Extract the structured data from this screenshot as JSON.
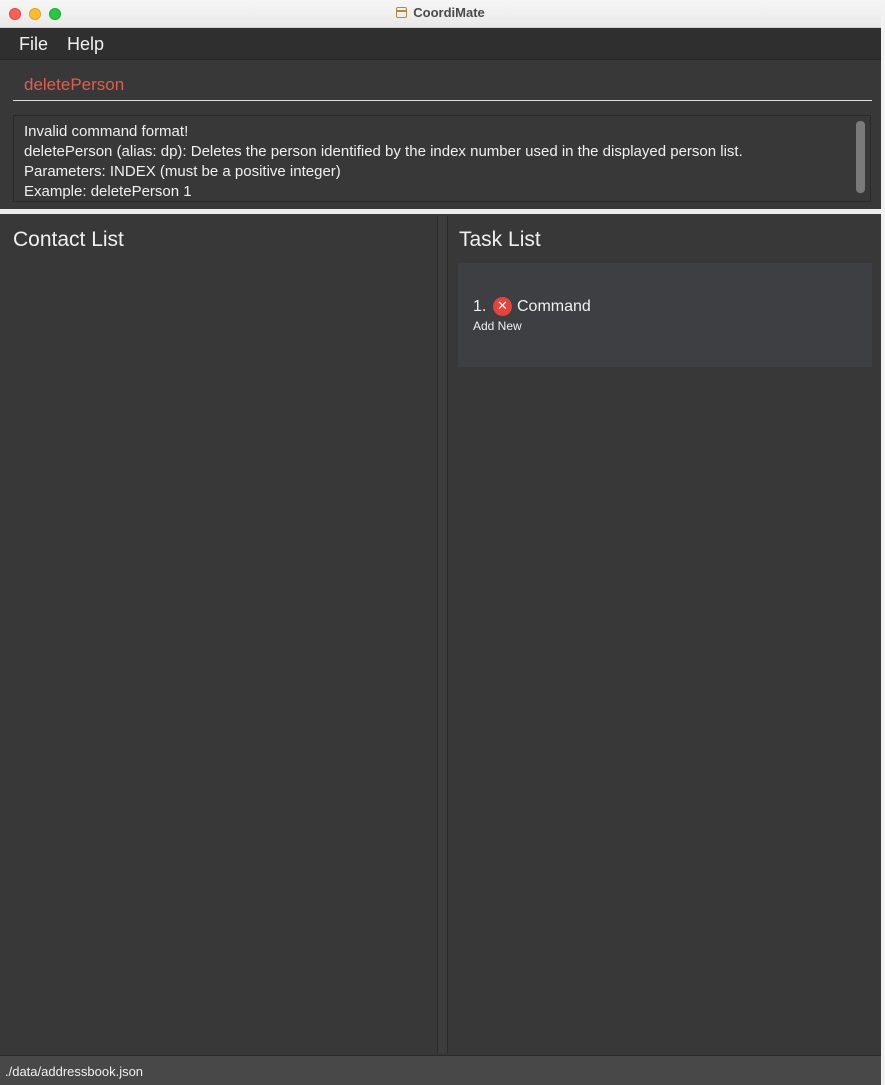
{
  "window": {
    "title": "CoordiMate",
    "title_icon": "calendar-icon"
  },
  "menu": {
    "items": [
      {
        "label": "File"
      },
      {
        "label": "Help"
      }
    ]
  },
  "command": {
    "value": "deletePerson",
    "text_color": "#e35d4c"
  },
  "result": {
    "text": "Invalid command format!\ndeletePerson (alias: dp): Deletes the person identified by the index number used in the displayed person list.\nParameters: INDEX (must be a positive integer)\nExample: deletePerson 1"
  },
  "contact_panel": {
    "title": "Contact List"
  },
  "task_panel": {
    "title": "Task List",
    "tasks": [
      {
        "index": "1.",
        "status": "not-done",
        "status_icon": "x-circle-icon",
        "status_color": "#e8423c",
        "name": "Command",
        "description": "Add New"
      }
    ]
  },
  "statusbar": {
    "path": "./data/addressbook.json"
  }
}
